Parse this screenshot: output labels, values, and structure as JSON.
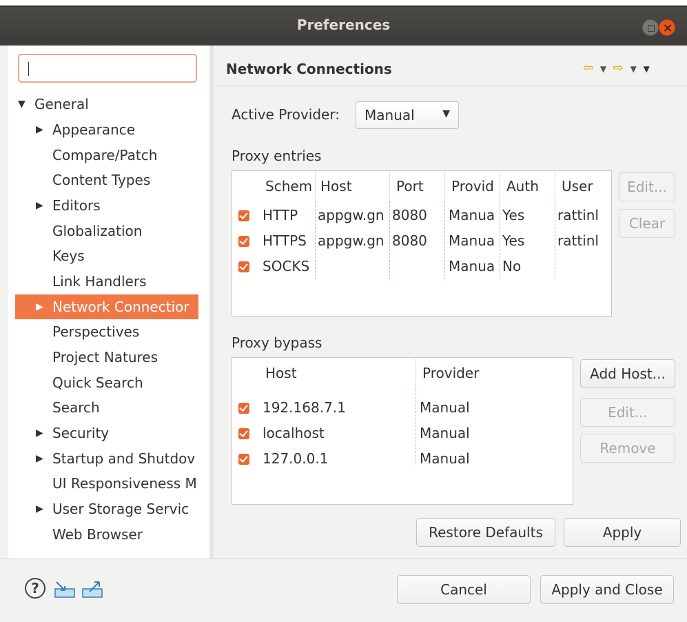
{
  "window": {
    "title": "Preferences"
  },
  "filter": {
    "value": ""
  },
  "tree": [
    {
      "label": "General",
      "arrow": "▼"
    },
    {
      "label": "Appearance",
      "arrow": "▶"
    },
    {
      "label": "Compare/Patch",
      "arrow": ""
    },
    {
      "label": "Content Types",
      "arrow": ""
    },
    {
      "label": "Editors",
      "arrow": "▶"
    },
    {
      "label": "Globalization",
      "arrow": ""
    },
    {
      "label": "Keys",
      "arrow": ""
    },
    {
      "label": "Link Handlers",
      "arrow": ""
    },
    {
      "label": "Network Connectior",
      "arrow": "▶"
    },
    {
      "label": "Perspectives",
      "arrow": ""
    },
    {
      "label": "Project Natures",
      "arrow": ""
    },
    {
      "label": "Quick Search",
      "arrow": ""
    },
    {
      "label": "Search",
      "arrow": ""
    },
    {
      "label": "Security",
      "arrow": "▶"
    },
    {
      "label": "Startup and Shutdov",
      "arrow": "▶"
    },
    {
      "label": "UI Responsiveness M",
      "arrow": ""
    },
    {
      "label": "User Storage Servic",
      "arrow": "▶"
    },
    {
      "label": "Web Browser",
      "arrow": ""
    }
  ],
  "page": {
    "title": "Network Connections",
    "nav": {
      "back": "⇦",
      "forward": "⇨",
      "dropdown": "▼"
    },
    "active_provider_label": "Active Provider:",
    "active_provider_value": "Manual",
    "combo_arrow": "▼"
  },
  "proxy_entries": {
    "label": "Proxy entries",
    "headers": [
      "Schem",
      "Host",
      "Port",
      "Provid",
      "Auth",
      "User"
    ],
    "rows": [
      {
        "scheme": "HTTP",
        "host": "appgw.gn",
        "port": "8080",
        "provider": "Manua",
        "auth": "Yes",
        "user": "rattinl"
      },
      {
        "scheme": "HTTPS",
        "host": "appgw.gn",
        "port": "8080",
        "provider": "Manua",
        "auth": "Yes",
        "user": "rattinl"
      },
      {
        "scheme": "SOCKS",
        "host": "",
        "port": "",
        "provider": "Manua",
        "auth": "No",
        "user": ""
      }
    ],
    "edit_button": "Edit...",
    "clear_button": "Clear"
  },
  "proxy_bypass": {
    "label": "Proxy bypass",
    "headers": [
      "Host",
      "Provider"
    ],
    "rows": [
      {
        "host": "192.168.7.1",
        "provider": "Manual"
      },
      {
        "host": "localhost",
        "provider": "Manual"
      },
      {
        "host": "127.0.0.1",
        "provider": "Manual"
      }
    ],
    "add_host_button": "Add Host...",
    "edit_button": "Edit...",
    "remove_button": "Remove"
  },
  "buttons": {
    "restore_defaults": "Restore Defaults",
    "apply": "Apply",
    "cancel": "Cancel",
    "apply_and_close": "Apply and Close"
  },
  "footer": {
    "help_glyph": "?"
  },
  "icons": {
    "help": "help-icon",
    "import": "import-icon",
    "export": "export-icon"
  },
  "colors": {
    "accent": "#f07746",
    "checkbox": "#e8682f",
    "titlebar": "#3c3b37",
    "close": "#e9541f"
  }
}
